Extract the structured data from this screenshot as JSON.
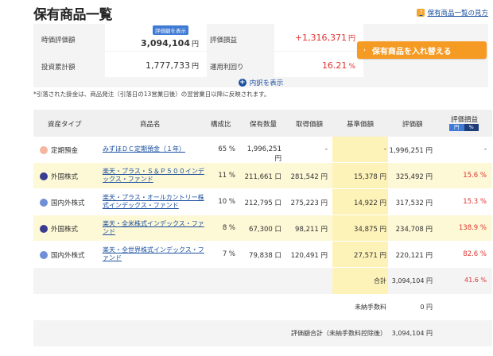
{
  "page_title": "保有商品一覧",
  "help_link": "保有商品一覧の見方",
  "help_icon_text": "?",
  "summary": {
    "market_value_label": "時価評価額",
    "market_value_badge": "評価額を表示",
    "market_value": "3,094,104",
    "market_value_unit": "円",
    "unrealized_label": "評価損益",
    "unrealized": "+1,316,371",
    "unrealized_unit": "円",
    "invested_label": "投資累計額",
    "invested": "1,777,733",
    "invested_unit": "円",
    "yield_label": "運用利回り",
    "yield": "16.21",
    "yield_unit": "%"
  },
  "swap_button": "保有商品を入れ替える",
  "swap_arrow": "›",
  "breakdown_label": "内訳を表示",
  "breakdown_icon": "+",
  "note": "*引落された掛金は、商品発注（引落日の13営業日後）の翌営業日以降に反映されます。",
  "table": {
    "headers": {
      "asset_type": "資産タイプ",
      "product": "商品名",
      "ratio": "構成比",
      "units": "保有数量",
      "cost": "取得価額",
      "base_price": "基準価額",
      "value": "評価額",
      "gain": "評価損益",
      "gain_toggle_yen": "円",
      "gain_toggle_pct": "%"
    },
    "rows": [
      {
        "dot_color": "#f4b6a0",
        "asset": "定期預金",
        "name": "みずほＤＣ定期預金（１年）",
        "ratio": "65 %",
        "units": "1,996,251 円",
        "cost": "-",
        "base": "-",
        "value": "1,996,251 円",
        "gain": "-",
        "gain_color": "#333333"
      },
      {
        "dot_color": "#3a3d8f",
        "asset": "外国株式",
        "name": "楽天・プラス・Ｓ＆Ｐ５００インデックス・ファンド",
        "ratio": "11 %",
        "units": "211,661 口",
        "cost": "281,542 円",
        "base": "15,378 円",
        "value": "325,492 円",
        "gain": "15.6 %",
        "gain_color": "#e0332f"
      },
      {
        "dot_color": "#6f8fd6",
        "asset": "国内外株式",
        "name": "楽天・プラス・オールカントリー株式インデックス・ファンド",
        "ratio": "10 %",
        "units": "212,795 口",
        "cost": "275,223 円",
        "base": "14,922 円",
        "value": "317,532 円",
        "gain": "15.3 %",
        "gain_color": "#e0332f"
      },
      {
        "dot_color": "#3a3d8f",
        "asset": "外国株式",
        "name": "楽天・全米株式インデックス・ファンド",
        "ratio": "8 %",
        "units": "67,300 口",
        "cost": "98,211 円",
        "base": "34,875 円",
        "value": "234,708 円",
        "gain": "138.9 %",
        "gain_color": "#e0332f"
      },
      {
        "dot_color": "#6f8fd6",
        "asset": "国内外株式",
        "name": "楽天・全世界株式インデックス・ファンド",
        "ratio": "7 %",
        "units": "79,838 口",
        "cost": "120,491 円",
        "base": "27,571 円",
        "value": "220,121 円",
        "gain": "82.6 %",
        "gain_color": "#e0332f"
      }
    ],
    "total_label": "合計",
    "total_value": "3,094,104 円",
    "total_gain": "41.6 %",
    "unpaid_fee_label": "未納手数料",
    "unpaid_fee_value": "0 円",
    "net_label": "評価額合計（未納手数料控除後）",
    "net_value": "3,094,104 円"
  }
}
